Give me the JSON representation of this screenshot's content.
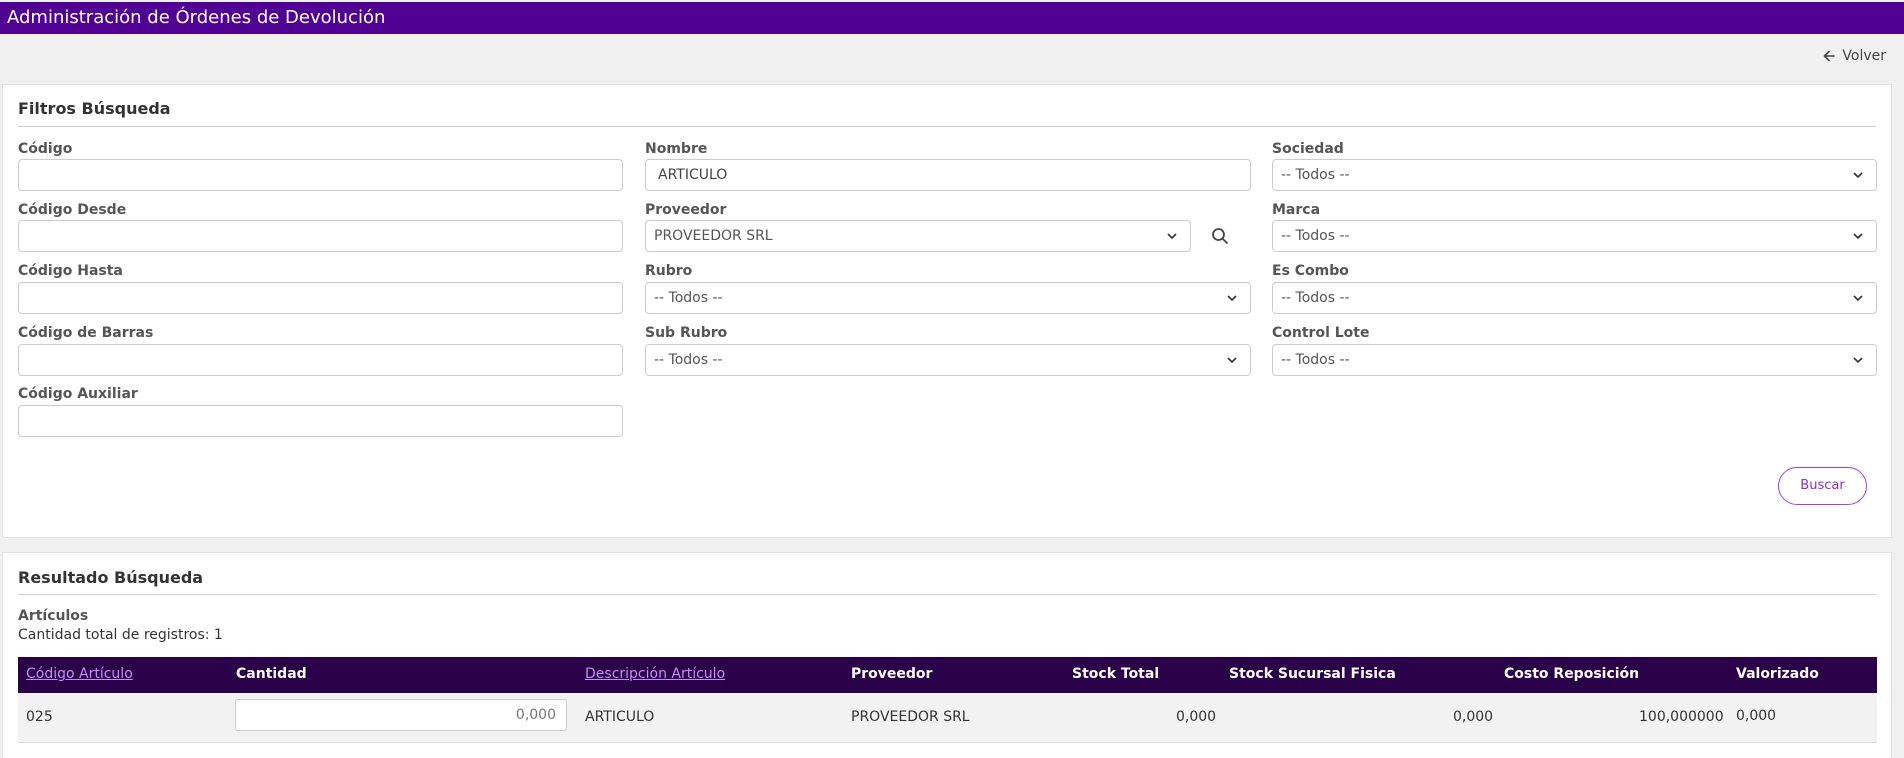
{
  "header": {
    "title": "Administración de Órdenes de Devolución"
  },
  "nav": {
    "back_label": "Volver"
  },
  "filters": {
    "title": "Filtros Búsqueda",
    "codigo": {
      "label": "Código",
      "value": ""
    },
    "codigo_desde": {
      "label": "Código Desde",
      "value": ""
    },
    "codigo_hasta": {
      "label": "Código Hasta",
      "value": ""
    },
    "codigo_barras": {
      "label": "Código de Barras",
      "value": ""
    },
    "codigo_auxiliar": {
      "label": "Código Auxiliar",
      "value": ""
    },
    "nombre": {
      "label": "Nombre",
      "value": "ARTICULO"
    },
    "proveedor": {
      "label": "Proveedor",
      "value": "PROVEEDOR SRL"
    },
    "rubro": {
      "label": "Rubro",
      "value": "-- Todos --"
    },
    "sub_rubro": {
      "label": "Sub Rubro",
      "value": "-- Todos --"
    },
    "sociedad": {
      "label": "Sociedad",
      "value": "-- Todos --"
    },
    "marca": {
      "label": "Marca",
      "value": "-- Todos --"
    },
    "es_combo": {
      "label": "Es Combo",
      "value": "-- Todos --"
    },
    "control_lote": {
      "label": "Control Lote",
      "value": "-- Todos --"
    },
    "search_button": "Buscar"
  },
  "results": {
    "title": "Resultado Búsqueda",
    "subtitle": "Artículos",
    "count_text": "Cantidad total de registros: 1",
    "columns": [
      "Código Artículo",
      "Cantidad",
      "Descripción Artículo",
      "Proveedor",
      "Stock Total",
      "Stock Sucursal Fisica",
      "Costo Reposición",
      "Valorizado"
    ],
    "rows": [
      {
        "codigo": "025",
        "cantidad": "0,000",
        "descripcion": "ARTICULO",
        "proveedor": "PROVEEDOR SRL",
        "stock_total": "0,000",
        "stock_sucursal": "0,000",
        "costo": "100,000000",
        "valorizado": "0,000"
      }
    ]
  },
  "colors": {
    "header_bg": "#510094",
    "table_header_bg": "#2a0048",
    "accent": "#8a2be2"
  }
}
